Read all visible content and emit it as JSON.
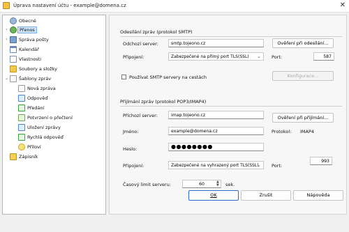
{
  "window": {
    "title": "Úprava nastavení účtu - example@domena.cz"
  },
  "tree": {
    "items": [
      {
        "label": "Obecné",
        "icon": "gear-icon",
        "expander": ""
      },
      {
        "label": "Přenos",
        "icon": "network-icon",
        "expander": "›"
      },
      {
        "label": "Správa pošty",
        "icon": "people-icon",
        "expander": "›"
      },
      {
        "label": "Kalendář",
        "icon": "calendar-icon",
        "expander": ""
      },
      {
        "label": "Vlastnosti",
        "icon": "document-icon",
        "expander": ""
      },
      {
        "label": "Soubory a složky",
        "icon": "folder-icon",
        "expander": ""
      },
      {
        "label": "Šablony zpráv",
        "icon": "template-icon",
        "expander": "⌄"
      },
      {
        "label": "Nová zpráva",
        "icon": "new-message-icon",
        "expander": ""
      },
      {
        "label": "Odpověď",
        "icon": "reply-icon",
        "expander": ""
      },
      {
        "label": "Předání",
        "icon": "forward-icon",
        "expander": ""
      },
      {
        "label": "Potvrzení o přečtení",
        "icon": "read-receipt-icon",
        "expander": ""
      },
      {
        "label": "Uložení zprávy",
        "icon": "save-message-icon",
        "expander": ""
      },
      {
        "label": "Rychlá odpověď",
        "icon": "quick-reply-icon",
        "expander": ""
      },
      {
        "label": "Příloví",
        "icon": "attachment-icon",
        "expander": ""
      },
      {
        "label": "Zápisník",
        "icon": "notebook-icon",
        "expander": ""
      }
    ]
  },
  "smtp": {
    "title": "Odesílání zpráv (protokol SMTP)",
    "server_label": "Odchozí server:",
    "server_value": "smtp.tojeono.cz",
    "verify_button": "Ověření při odesílání...",
    "connection_label": "Připojení:",
    "connection_value": "Zabezpečené na přímý port TLS(SSL)",
    "port_label": "Port:",
    "port_value": "587",
    "use_servers_label": "Používat SMTP servery na cestách",
    "configure_button": "Konfigurace..."
  },
  "pop": {
    "title": "Přijímání zpráv (protokol POP3/IMAP4)",
    "server_label": "Příchozí server:",
    "server_value": "imap.tojeono.cz",
    "verify_button": "Ověření při přijímání...",
    "name_label": "Jméno:",
    "name_value": "example@domena.cz",
    "protocol_label": "Protokol:",
    "protocol_value": "IMAP4",
    "password_label": "Heslo:",
    "password_value": "●●●●●●●●",
    "connection_label": "Připojení:",
    "connection_value": "Zabezpečené na vyhrazený port TLS(SSL)",
    "port_label": "Port:",
    "port_value": "993"
  },
  "timeout": {
    "label": "Časový limit serveru:",
    "value": "60",
    "unit": "sek."
  },
  "footer": {
    "ok": "OK",
    "cancel": "Zrušit",
    "help": "Nápověda"
  }
}
